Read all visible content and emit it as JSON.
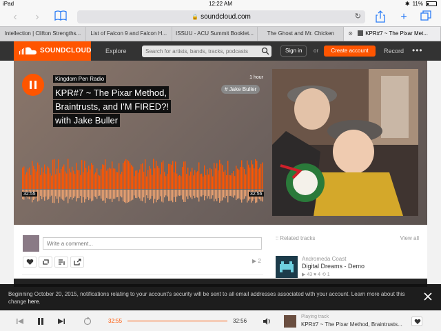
{
  "status": {
    "device": "iPad",
    "time": "12:22 AM",
    "battery": "11%",
    "battery_level": 0.11
  },
  "browser": {
    "url": "soundcloud.com",
    "tabs": [
      "Intellection | Clifton Strengths...",
      "List of Falcon 9 and Falcon H...",
      "ISSUU - ACU Summit Booklet...",
      "The Ghost and Mr. Chicken",
      "KPR#7 ~ The Pixar Met..."
    ]
  },
  "header": {
    "logo": "SOUNDCLOUD",
    "explore": "Explore",
    "search_placeholder": "Search for artists, bands, tracks, podcasts",
    "signin": "Sign in",
    "or": "or",
    "create": "Create account",
    "record": "Record",
    "more": "•••"
  },
  "track": {
    "artist": "Kingdom Pen Radio",
    "title_lines": [
      "KPR#7 ~ The Pixar Method,",
      "Braintrusts, and I'M FIRED?!",
      "with Jake Buller"
    ],
    "age": "1 hour",
    "tag": "# Jake Buller",
    "time_elapsed": "32:55",
    "time_total": "32:56",
    "progress": 0.999,
    "brand_color": "#ff5500"
  },
  "comments": {
    "placeholder": "Write a comment...",
    "plays": "▶ 2"
  },
  "related": {
    "heading": "Related tracks",
    "view_all": "View all",
    "items": [
      {
        "artist": "Andromeda Coast",
        "title": "Digital Dreams - Demo",
        "stats": "▶ 43  ♥ 4  ⟲ 1"
      }
    ]
  },
  "notice": {
    "text": "Beginning October 20, 2015, notifications relating to your account's security will be sent to all email addresses associated with your account. Learn more about this change ",
    "link": "here",
    "end": "."
  },
  "player": {
    "elapsed": "32:55",
    "total": "32:56",
    "playing_label": "Playing track",
    "now_title": "KPR#7 ~ The Pixar Method, Braintrusts..."
  }
}
